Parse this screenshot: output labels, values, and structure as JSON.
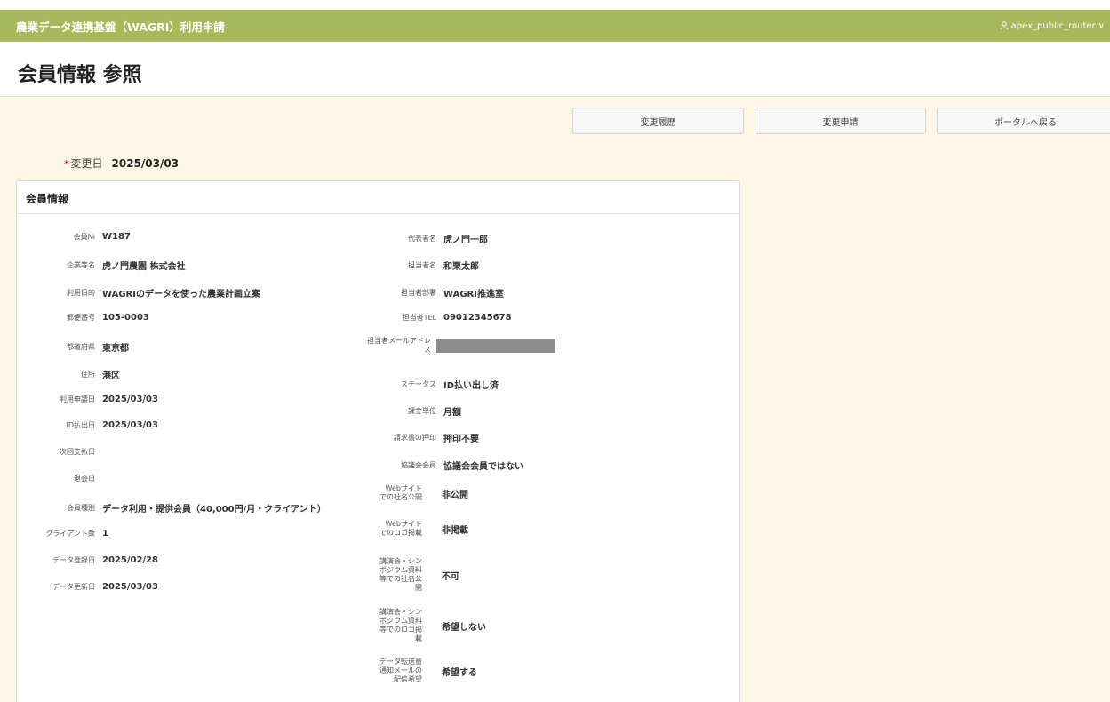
{
  "header": {
    "app_title": "農業データ連携基盤（WAGRI）利用申請",
    "user_name": "apex_public_router",
    "user_icon": "user-icon",
    "chevron": "∨"
  },
  "page": {
    "title": "会員情報 参照"
  },
  "buttons": {
    "history": "変更履歴",
    "change": "変更申請",
    "portal": "ポータルへ戻る"
  },
  "change_date": {
    "required_mark": "*",
    "label": "変更日",
    "value": "2025/03/03"
  },
  "card": {
    "title": "会員情報",
    "left": [
      {
        "label": "会員№",
        "value": "W187"
      },
      {
        "label": "企業等名",
        "value": "虎ノ門農園 株式会社"
      },
      {
        "label": "利用目的",
        "value": "WAGRIのデータを使った農業計画立案"
      },
      {
        "label": "郵便番号",
        "value": "105-0003"
      },
      {
        "label": "都道府県",
        "value": "東京都"
      },
      {
        "label": "住所",
        "value": "港区"
      },
      {
        "label": "利用申請日",
        "value": "2025/03/03"
      },
      {
        "label": "ID払出日",
        "value": "2025/03/03"
      },
      {
        "label": "次回支払日",
        "value": ""
      },
      {
        "label": "退会日",
        "value": ""
      },
      {
        "label": "会員種別",
        "value": "データ利用・提供会員（40,000円/月・クライアント）"
      },
      {
        "label": "クライアント数",
        "value": "1"
      },
      {
        "label": "データ登録日",
        "value": "2025/02/28"
      },
      {
        "label": "データ更新日",
        "value": "2025/03/03"
      }
    ],
    "right": [
      {
        "label": "代表者名",
        "value": "虎ノ門一郎"
      },
      {
        "label": "担当者名",
        "value": "和栗太郎"
      },
      {
        "label": "担当者部署",
        "value": "WAGRI推進室"
      },
      {
        "label": "担当者TEL",
        "value": "09012345678"
      },
      {
        "label": "担当者メールアドレス",
        "value": ""
      },
      {
        "label": "ステータス",
        "value": "ID払い出し済"
      },
      {
        "label": "課金単位",
        "value": "月額"
      },
      {
        "label": "請求書の押印",
        "value": "押印不要"
      },
      {
        "label": "協議会会員",
        "value": "協議会会員ではない"
      },
      {
        "label": "Webサイトでの社名公開",
        "value": "非公開"
      },
      {
        "label": "Webサイトでのロゴ掲載",
        "value": "非掲載"
      },
      {
        "label": "講演会・シンポジウム資料等での社名公開",
        "value": "不可"
      },
      {
        "label": "講演会・シンポジウム資料等でのロゴ掲載",
        "value": "希望しない"
      },
      {
        "label": "データ転送量通知メールの配信希望",
        "value": "希望する"
      }
    ]
  }
}
